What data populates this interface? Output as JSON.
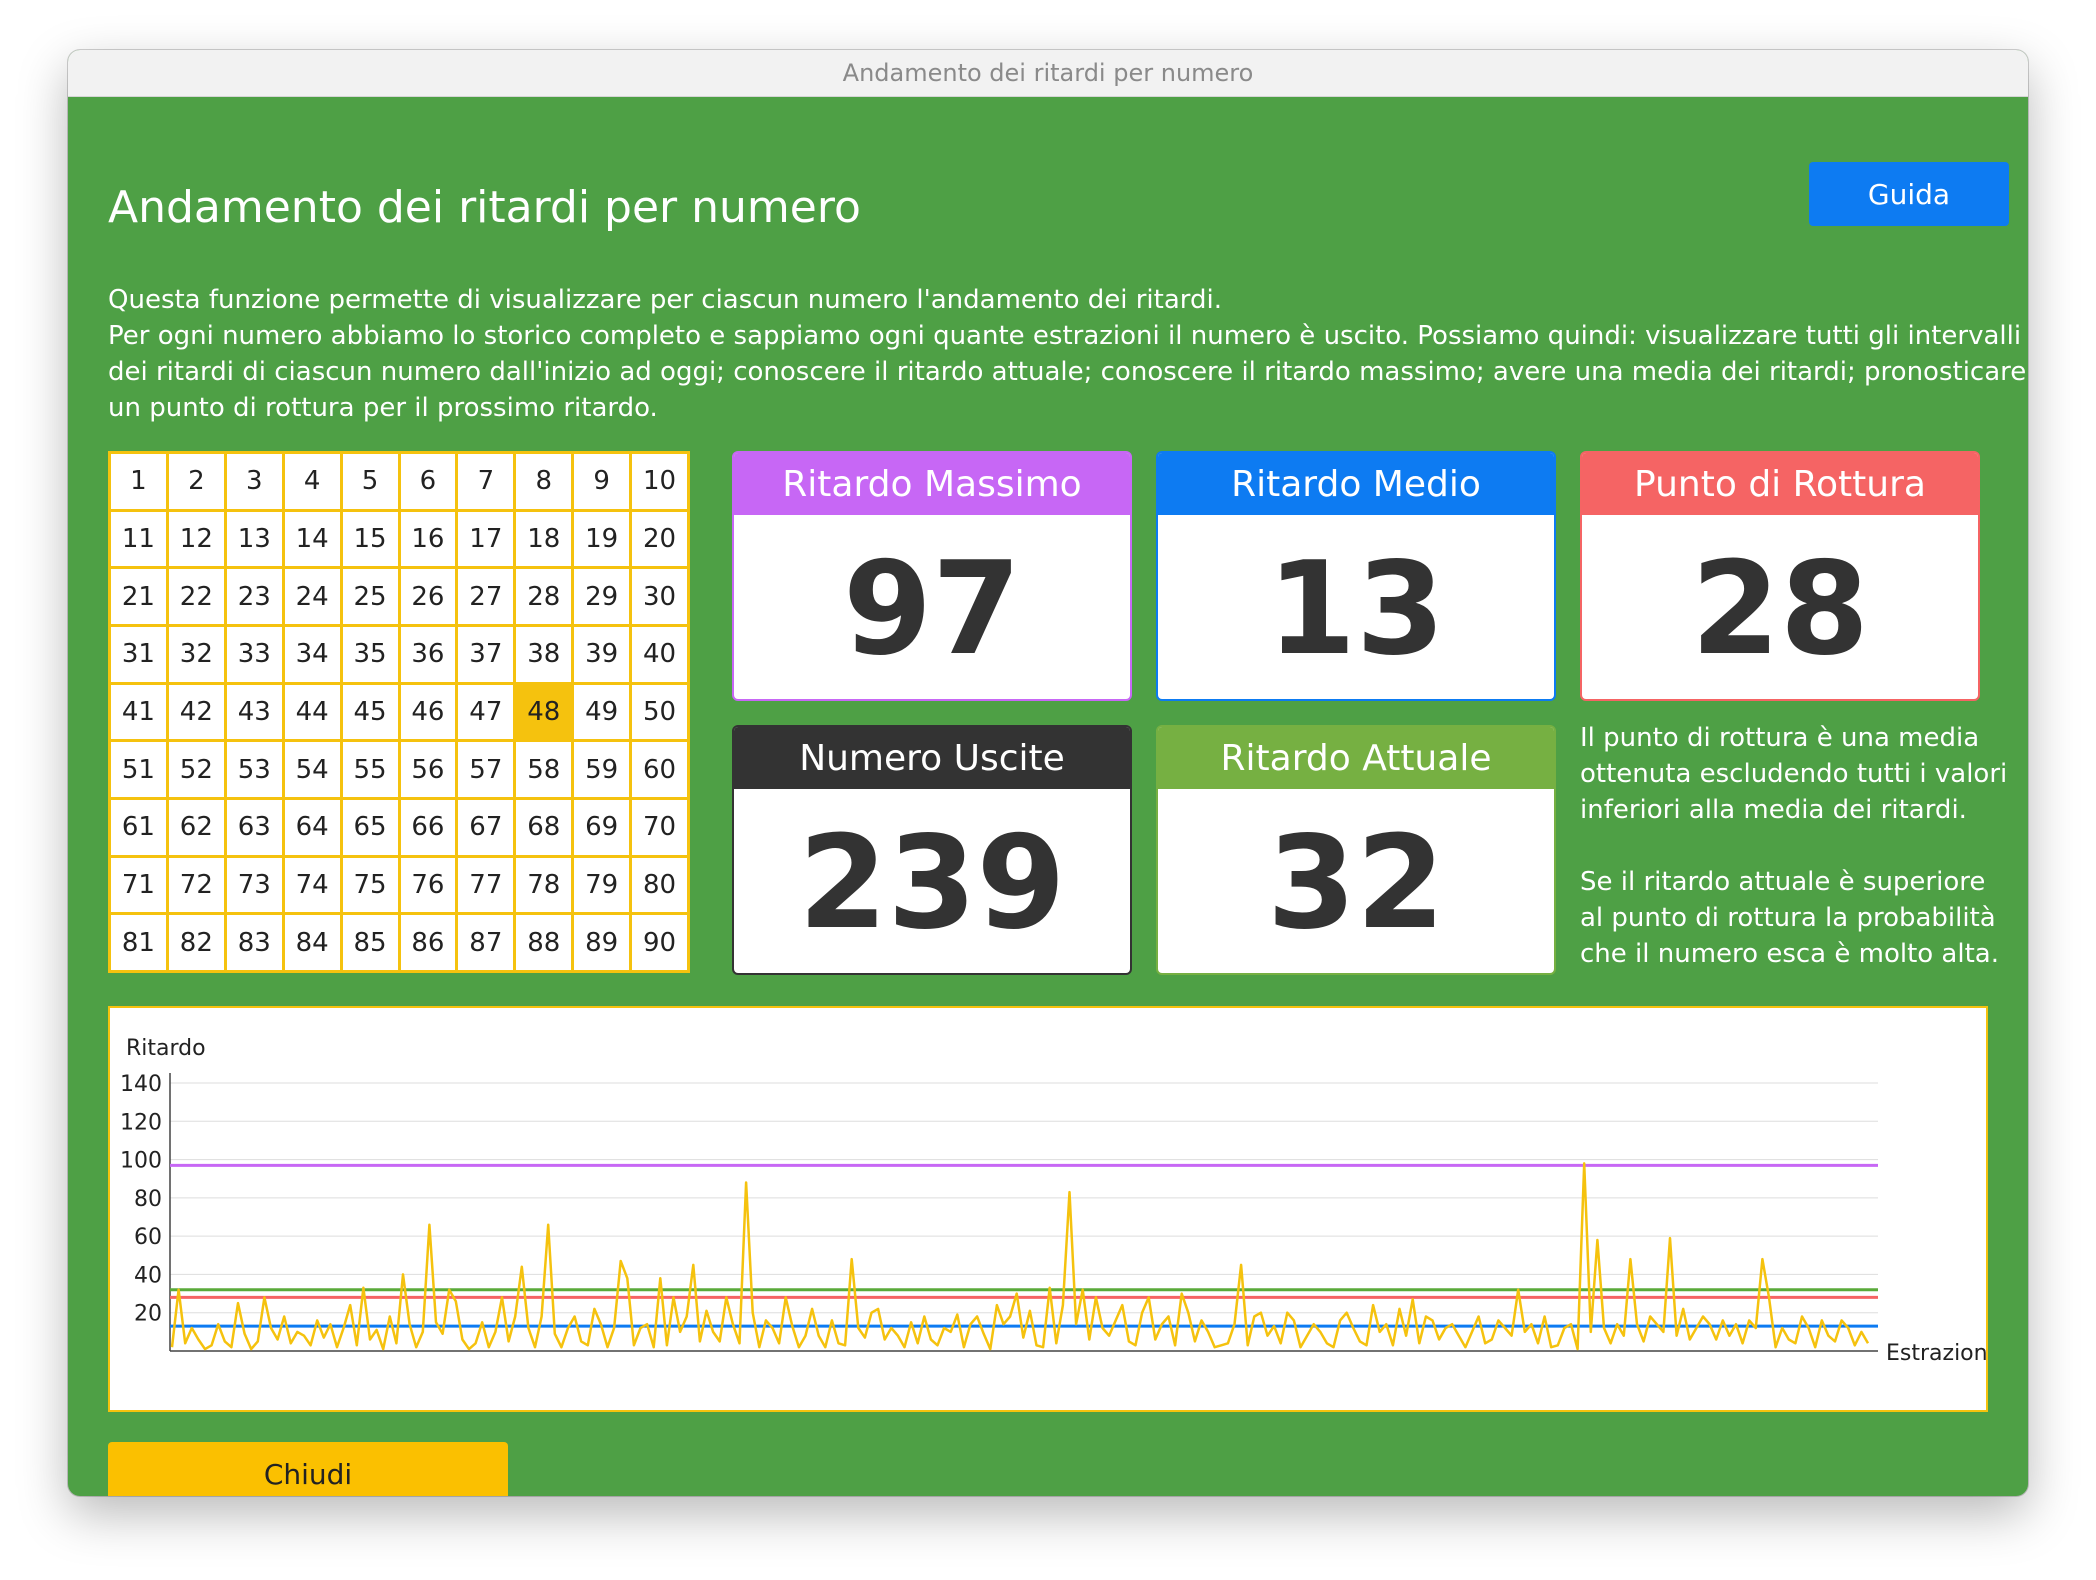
{
  "window": {
    "title": "Andamento dei ritardi per numero"
  },
  "header": {
    "title": "Andamento dei ritardi per numero",
    "guide_label": "Guida"
  },
  "description": {
    "paragraphs": [
      "Questa funzione permette di visualizzare per ciascun numero l'andamento dei ritardi.",
      "Per ogni numero abbiamo lo storico completo e sappiamo ogni quante estrazioni il numero è uscito. Possiamo quindi: visualizzare tutti gli intervalli",
      "dei ritardi di ciascun numero dall'inizio ad oggi; conoscere il ritardo attuale; conoscere il ritardo massimo; avere una media dei ritardi; pronosticare",
      "un punto di rottura per il prossimo ritardo."
    ]
  },
  "number_grid": {
    "selected": 48,
    "numbers": [
      1,
      2,
      3,
      4,
      5,
      6,
      7,
      8,
      9,
      10,
      11,
      12,
      13,
      14,
      15,
      16,
      17,
      18,
      19,
      20,
      21,
      22,
      23,
      24,
      25,
      26,
      27,
      28,
      29,
      30,
      31,
      32,
      33,
      34,
      35,
      36,
      37,
      38,
      39,
      40,
      41,
      42,
      43,
      44,
      45,
      46,
      47,
      48,
      49,
      50,
      51,
      52,
      53,
      54,
      55,
      56,
      57,
      58,
      59,
      60,
      61,
      62,
      63,
      64,
      65,
      66,
      67,
      68,
      69,
      70,
      71,
      72,
      73,
      74,
      75,
      76,
      77,
      78,
      79,
      80,
      81,
      82,
      83,
      84,
      85,
      86,
      87,
      88,
      89,
      90
    ]
  },
  "stats": {
    "max": {
      "label": "Ritardo Massimo",
      "value": "97",
      "color": "#c767f5"
    },
    "avg": {
      "label": "Ritardo Medio",
      "value": "13",
      "color": "#0d7bf2"
    },
    "break": {
      "label": "Punto di Rottura",
      "value": "28",
      "color": "#f56464"
    },
    "count": {
      "label": "Numero Uscite",
      "value": "239",
      "color": "#333333"
    },
    "current": {
      "label": "Ritardo Attuale",
      "value": "32",
      "color": "#76b042"
    }
  },
  "side_note": {
    "p1": "Il punto di rottura è una media ottenuta escludendo tutti i valori inferiori alla media dei ritardi.",
    "p2": "Se il ritardo attuale è superiore al punto di rottura la probabilità che il numero esca è molto alta."
  },
  "chart_data": {
    "type": "line",
    "xlabel": "Estrazioni",
    "ylabel": "Ritardo",
    "ylim": [
      0,
      140
    ],
    "yticks": [
      20,
      40,
      60,
      80,
      100,
      120,
      140
    ],
    "grid": true,
    "series": [],
    "values": [
      2,
      32,
      4,
      12,
      6,
      1,
      3,
      14,
      5,
      2,
      25,
      9,
      1,
      5,
      28,
      12,
      6,
      18,
      4,
      10,
      8,
      3,
      16,
      7,
      14,
      2,
      12,
      24,
      3,
      33,
      6,
      11,
      1,
      18,
      4,
      40,
      14,
      2,
      10,
      66,
      15,
      9,
      32,
      26,
      6,
      1,
      4,
      15,
      2,
      10,
      28,
      5,
      18,
      44,
      12,
      2,
      18,
      66,
      9,
      2,
      12,
      18,
      5,
      3,
      22,
      14,
      2,
      12,
      47,
      38,
      3,
      12,
      14,
      2,
      38,
      3,
      28,
      10,
      18,
      45,
      5,
      21,
      10,
      5,
      28,
      14,
      4,
      88,
      20,
      2,
      16,
      12,
      4,
      28,
      13,
      2,
      8,
      22,
      8,
      2,
      16,
      4,
      3,
      48,
      12,
      7,
      20,
      22,
      6,
      12,
      8,
      2,
      15,
      4,
      18,
      6,
      3,
      12,
      10,
      19,
      2,
      14,
      18,
      9,
      1,
      24,
      14,
      18,
      30,
      7,
      21,
      3,
      2,
      33,
      4,
      24,
      83,
      14,
      32,
      6,
      28,
      12,
      8,
      16,
      24,
      5,
      3,
      20,
      28,
      6,
      14,
      18,
      3,
      30,
      20,
      5,
      16,
      10,
      2,
      3,
      4,
      14,
      45,
      3,
      18,
      20,
      8,
      13,
      4,
      20,
      16,
      2,
      8,
      14,
      10,
      4,
      2,
      16,
      20,
      12,
      5,
      3,
      24,
      10,
      14,
      3,
      22,
      8,
      27,
      4,
      18,
      16,
      6,
      12,
      14,
      8,
      2,
      10,
      18,
      4,
      6,
      16,
      12,
      8,
      32,
      10,
      14,
      4,
      18,
      2,
      3,
      12,
      14,
      1,
      98,
      10,
      58,
      12,
      4,
      14,
      8,
      48,
      14,
      5,
      18,
      14,
      10,
      59,
      8,
      22,
      6,
      12,
      18,
      14,
      6,
      16,
      8,
      14,
      4,
      16,
      12,
      48,
      28,
      2,
      12,
      6,
      4,
      18,
      12,
      2,
      16,
      8,
      5,
      16,
      12,
      3,
      10,
      4
    ],
    "reference_lines": [
      {
        "name": "Ritardo Massimo",
        "value": 97,
        "color": "#c767f5"
      },
      {
        "name": "Ritardo Attuale",
        "value": 32,
        "color": "#5aaa3a"
      },
      {
        "name": "Punto di Rottura",
        "value": 28,
        "color": "#f56464"
      },
      {
        "name": "Ritardo Medio",
        "value": 13,
        "color": "#0d7bf2"
      }
    ],
    "line_color": "#f5c20e"
  },
  "footer": {
    "close_label": "Chiudi"
  }
}
